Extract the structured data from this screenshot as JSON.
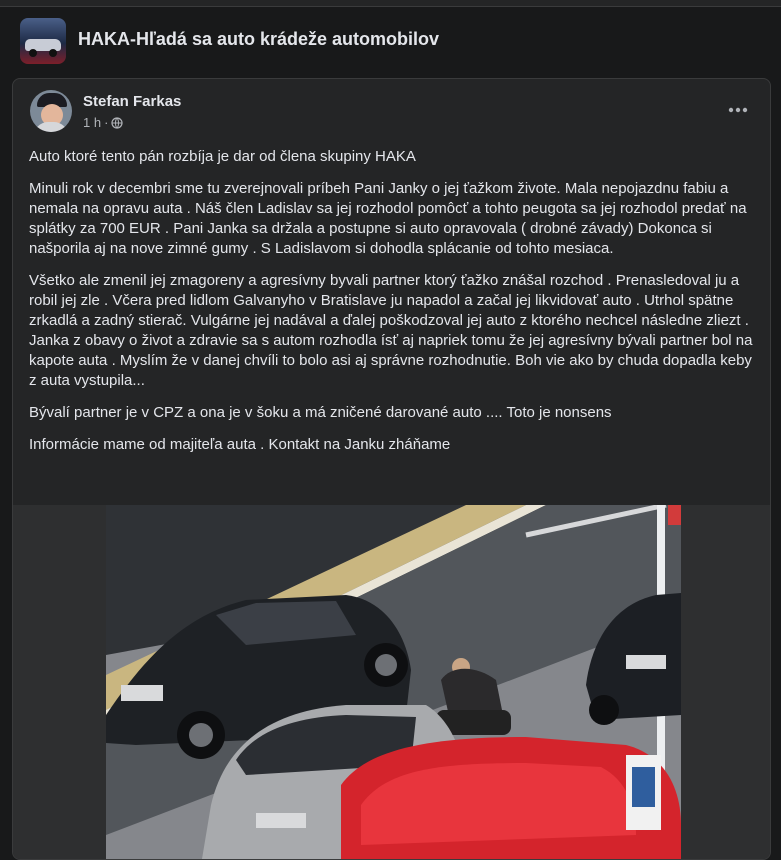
{
  "group": {
    "title": "HAKA-Hľadá sa auto krádeže automobilov",
    "thumb_icon": "group-cover-image"
  },
  "post": {
    "author": "Stefan Farkas",
    "time": "1 h",
    "separator": "·",
    "privacy_icon": "globe-icon",
    "more_icon": "more-options-icon",
    "paragraphs": [
      "Auto ktoré tento pán rozbíja je dar od člena skupiny  HAKA",
      "Minuli rok v decembri sme tu zverejnovali príbeh Pani Janky o jej ťažkom živote.  Mala nepojazdnu fabiu a nemala na opravu auta . Náš člen Ladislav sa jej rozhodol pomôcť a tohto peugota sa jej rozhodol predať na splátky za 700 EUR . Pani Janka sa držala a postupne si auto opravovala ( drobné závady) Dokonca si našporila aj na nove zimné gumy . S Ladislavom si dohodla splácanie od tohto mesiaca.",
      "Všetko ale zmenil jej zmagoreny a agresívny byvali partner ktorý ťažko znášal rozchod . Prenasledoval ju a robil jej zle . Včera pred lidlom Galvanyho v Bratislave ju napadol a začal jej likvidovať auto . Utrhol spätne zrkadlá a zadný stierač.  Vulgárne jej nadával a ďalej poškodzoval jej auto z ktorého nechcel následne zliezt . Janka z obavy o život a zdravie sa s autom rozhodla ísť aj napriek tomu že jej agresívny bývali partner bol na kapote auta . Myslím že v danej chvíli to bolo asi aj správne rozhodnutie.  Boh vie ako by chuda dopadla keby z auta vystupila...",
      "Bývalí partner je v CPZ a ona je v šoku a má zničené darované auto .... Toto je nonsens",
      "Informácie mame od majiteľa auta . Kontakt na Janku zháňame"
    ]
  },
  "colors": {
    "page_bg": "#18191a",
    "card_bg": "#242526",
    "text_primary": "#e4e6eb",
    "text_secondary": "#b0b3b8"
  }
}
